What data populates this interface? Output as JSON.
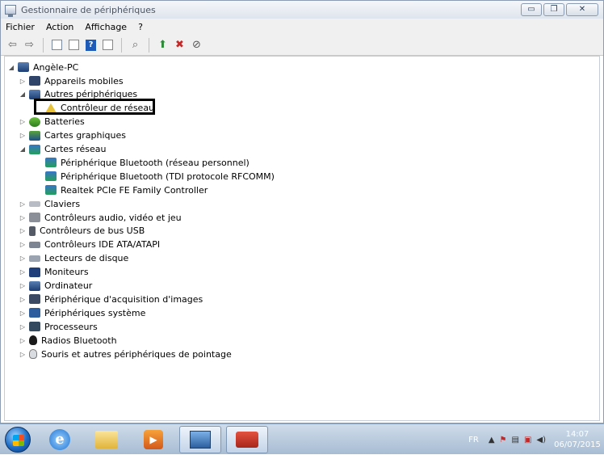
{
  "window": {
    "title": "Gestionnaire de périphériques",
    "buttons": {
      "minimize": "▭",
      "maximize": "❐",
      "close": "✕"
    }
  },
  "menu": [
    "Fichier",
    "Action",
    "Affichage",
    "?"
  ],
  "toolbar": {
    "icons": [
      "back-icon",
      "forward-icon",
      "properties-icon",
      "view-icon",
      "help-icon",
      "view2-icon",
      "scan-icon",
      "update-driver-icon",
      "uninstall-icon",
      "disable-icon"
    ],
    "help_glyph": "?"
  },
  "tree": {
    "root": "Angèle-PC",
    "nodes": [
      {
        "label": "Appareils mobiles",
        "expander": "▷",
        "icon": "mobile-icon"
      },
      {
        "label": "Autres périphériques",
        "expander": "◢",
        "icon": "other-devices-icon"
      },
      {
        "label": "Contrôleur de réseau",
        "expander": "",
        "icon": "warning-icon",
        "child": true
      },
      {
        "label": "Batteries",
        "expander": "▷",
        "icon": "battery-icon"
      },
      {
        "label": "Cartes graphiques",
        "expander": "▷",
        "icon": "display-adapter-icon"
      },
      {
        "label": "Cartes réseau",
        "expander": "◢",
        "icon": "network-adapter-icon"
      },
      {
        "label": "Périphérique Bluetooth (réseau personnel)",
        "expander": "",
        "icon": "network-adapter-icon",
        "child": true
      },
      {
        "label": "Périphérique Bluetooth (TDI protocole RFCOMM)",
        "expander": "",
        "icon": "network-adapter-icon",
        "child": true
      },
      {
        "label": "Realtek PCIe FE Family Controller",
        "expander": "",
        "icon": "network-adapter-icon",
        "child": true
      },
      {
        "label": "Claviers",
        "expander": "▷",
        "icon": "keyboard-icon"
      },
      {
        "label": "Contrôleurs audio, vidéo et jeu",
        "expander": "▷",
        "icon": "audio-icon"
      },
      {
        "label": "Contrôleurs de bus USB",
        "expander": "▷",
        "icon": "usb-icon"
      },
      {
        "label": "Contrôleurs IDE ATA/ATAPI",
        "expander": "▷",
        "icon": "ide-icon"
      },
      {
        "label": "Lecteurs de disque",
        "expander": "▷",
        "icon": "disk-icon"
      },
      {
        "label": "Moniteurs",
        "expander": "▷",
        "icon": "monitor-icon"
      },
      {
        "label": "Ordinateur",
        "expander": "▷",
        "icon": "computer-icon"
      },
      {
        "label": "Périphérique d'acquisition d'images",
        "expander": "▷",
        "icon": "camera-icon"
      },
      {
        "label": "Périphériques système",
        "expander": "▷",
        "icon": "system-icon"
      },
      {
        "label": "Processeurs",
        "expander": "▷",
        "icon": "processor-icon"
      },
      {
        "label": "Radios Bluetooth",
        "expander": "▷",
        "icon": "bluetooth-icon"
      },
      {
        "label": "Souris et autres périphériques de pointage",
        "expander": "▷",
        "icon": "mouse-icon"
      }
    ]
  },
  "taskbar": {
    "language": "FR",
    "time": "14:07",
    "date": "06/07/2015",
    "tray_arrow": "▲",
    "media_glyph": "▶"
  }
}
